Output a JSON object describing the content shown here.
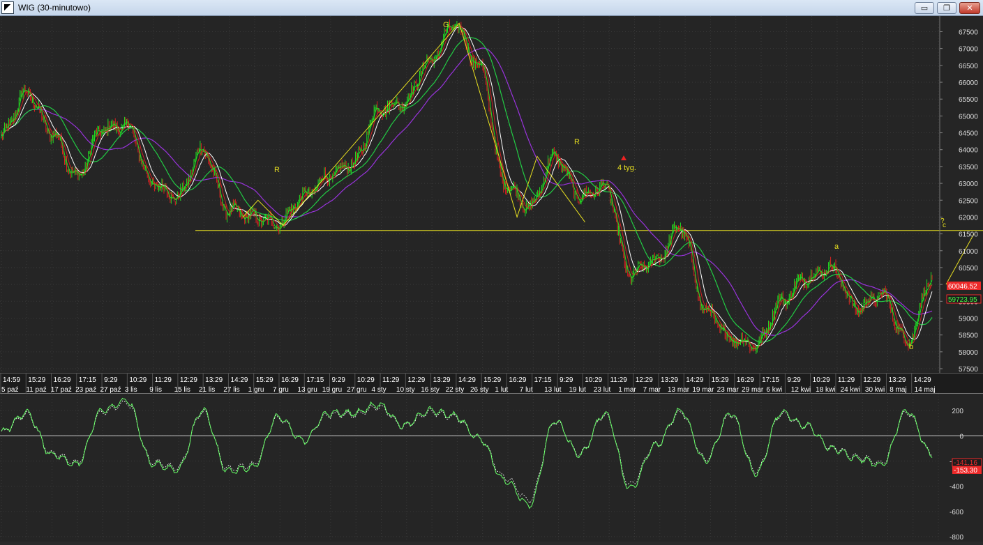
{
  "window": {
    "title": "WIG (30-minutowo)",
    "buttons": {
      "minimize": "▭",
      "maximize": "❐",
      "close": "✕"
    }
  },
  "colors": {
    "background": "#252525",
    "grid": "#3a3a3a",
    "annotation": "#e8e020",
    "candle_up": "#22dd22",
    "candle_down": "#dd2222",
    "ma_white": "#ffffff",
    "ma_red": "#cc2222",
    "ma_green": "#22cc44",
    "ma_purple": "#9933dd",
    "oscillator": "#66ff66"
  },
  "price_axis": {
    "labels": [
      "67500",
      "67000",
      "66500",
      "66000",
      "65500",
      "65000",
      "64500",
      "64000",
      "63500",
      "63000",
      "62500",
      "62000",
      "61500",
      "61000",
      "60500",
      "60000",
      "59500",
      "59000",
      "58500",
      "58000",
      "57500"
    ],
    "current_red": "60046.52",
    "current_green": "59723.95"
  },
  "oscillator_axis": {
    "labels": [
      "200",
      "0",
      "-200",
      "-400",
      "-600",
      "-800"
    ],
    "current_red": "-141.16",
    "current_green": "-153.30"
  },
  "time_axis": {
    "times": [
      "14:59",
      "15:29",
      "16:29",
      "17:15",
      "9:29",
      "10:29",
      "11:29",
      "12:29",
      "13:29",
      "14:29",
      "15:29",
      "16:29",
      "17:15",
      "9:29",
      "10:29",
      "11:29",
      "12:29",
      "13:29",
      "14:29",
      "15:29",
      "16:29",
      "17:15",
      "9:29",
      "10:29",
      "11:29",
      "12:29",
      "13:29",
      "14:29",
      "15:29",
      "16:29",
      "17:15",
      "9:29",
      "10:29",
      "11:29",
      "12:29",
      "13:29",
      "14:29"
    ],
    "dates": [
      "5 paź",
      "11 paź",
      "17 paź",
      "23 paź",
      "27 paź",
      "3 lis",
      "9 lis",
      "15 lis",
      "21 lis",
      "27 lis",
      "1 gru",
      "7 gru",
      "13 gru",
      "19 gru",
      "27 gru",
      "4 sty",
      "10 sty",
      "16 sty",
      "22 sty",
      "26 sty",
      "1 lut",
      "7 lut",
      "13 lut",
      "19 lut",
      "23 lut",
      "1 mar",
      "7 mar",
      "13 mar",
      "19 mar",
      "23 mar",
      "29 mar",
      "6 kwi",
      "12 kwi",
      "18 kwi",
      "24 kwi",
      "30 kwi",
      "8 maj",
      "14 maj"
    ]
  },
  "annotations": {
    "g": "G",
    "r1": "R",
    "r2": "R",
    "weeks": "4 tyg.",
    "a": "a",
    "b": "b",
    "c": "c",
    "q": "?"
  },
  "chart_data": [
    {
      "type": "line",
      "description_units": "WIG index, 30-minute bars",
      "x": [
        "5 paź",
        "11 paź",
        "17 paź",
        "23 paź",
        "27 paź",
        "3 lis",
        "9 lis",
        "15 lis",
        "21 lis",
        "27 lis",
        "1 gru",
        "7 gru",
        "13 gru",
        "19 gru",
        "27 gru",
        "4 sty",
        "10 sty",
        "16 sty",
        "22 sty",
        "26 sty",
        "1 lut",
        "7 lut",
        "13 lut",
        "19 lut",
        "23 lut",
        "1 mar",
        "7 mar",
        "13 mar",
        "19 mar",
        "23 mar",
        "29 mar",
        "6 kwi",
        "12 kwi",
        "18 kwi",
        "24 kwi",
        "30 kwi",
        "8 maj",
        "14 maj"
      ],
      "series": [
        {
          "name": "WIG",
          "values": [
            64400,
            65700,
            64500,
            63200,
            64600,
            64700,
            63000,
            62600,
            64000,
            62200,
            62000,
            61800,
            62600,
            63200,
            63600,
            65200,
            65400,
            66600,
            67700,
            66500,
            63000,
            62300,
            63800,
            62600,
            62900,
            60300,
            60700,
            61700,
            59200,
            58400,
            58200,
            59500,
            60200,
            60500,
            59300,
            59700,
            58300,
            60200
          ]
        }
      ],
      "ylim": [
        57500,
        67800
      ],
      "hline": 61600
    },
    {
      "type": "line",
      "x": [
        "5 paź",
        "11 paź",
        "17 paź",
        "23 paź",
        "27 paź",
        "3 lis",
        "9 lis",
        "15 lis",
        "21 lis",
        "27 lis",
        "1 gru",
        "7 gru",
        "13 gru",
        "19 gru",
        "27 gru",
        "4 sty",
        "10 sty",
        "16 sty",
        "22 sty",
        "26 sty",
        "1 lut",
        "7 lut",
        "13 lut",
        "19 lut",
        "23 lut",
        "1 mar",
        "7 mar",
        "13 mar",
        "19 mar",
        "23 mar",
        "29 mar",
        "6 kwi",
        "12 kwi",
        "18 kwi",
        "24 kwi",
        "30 kwi",
        "8 maj",
        "14 maj"
      ],
      "series": [
        {
          "name": "",
          "values": [
            30,
            180,
            -150,
            -230,
            200,
            280,
            -220,
            -270,
            200,
            -280,
            -250,
            150,
            -40,
            180,
            180,
            250,
            80,
            200,
            160,
            -20,
            -350,
            -550,
            120,
            -150,
            180,
            -420,
            -80,
            200,
            -200,
            180,
            -300,
            180,
            80,
            -100,
            -180,
            -230,
            200,
            -150
          ]
        }
      ],
      "ylim": [
        -800,
        300
      ]
    }
  ]
}
